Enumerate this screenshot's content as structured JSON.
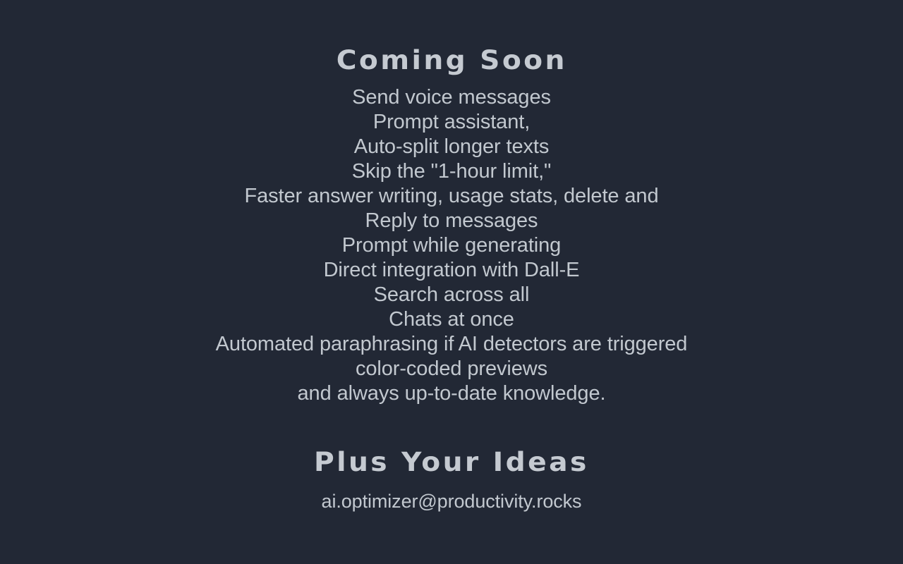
{
  "background_color": "#222835",
  "text_color": "#c2c8cf",
  "heading_color": "#c5cad1",
  "sections": {
    "coming_soon": {
      "heading": "Coming Soon",
      "features": [
        "Send voice messages",
        "Prompt assistant,",
        "Auto-split longer texts",
        "Skip the \"1-hour limit,\"",
        "Faster answer writing, usage stats, delete and",
        "Reply to messages",
        "Prompt while generating",
        "Direct integration with Dall-E",
        "Search across all",
        "Chats at once",
        "Automated paraphrasing if AI detectors are triggered",
        "color-coded previews",
        "and always up-to-date knowledge."
      ]
    },
    "plus_your_ideas": {
      "heading": "Plus Your Ideas",
      "email": "ai.optimizer@productivity.rocks"
    }
  }
}
